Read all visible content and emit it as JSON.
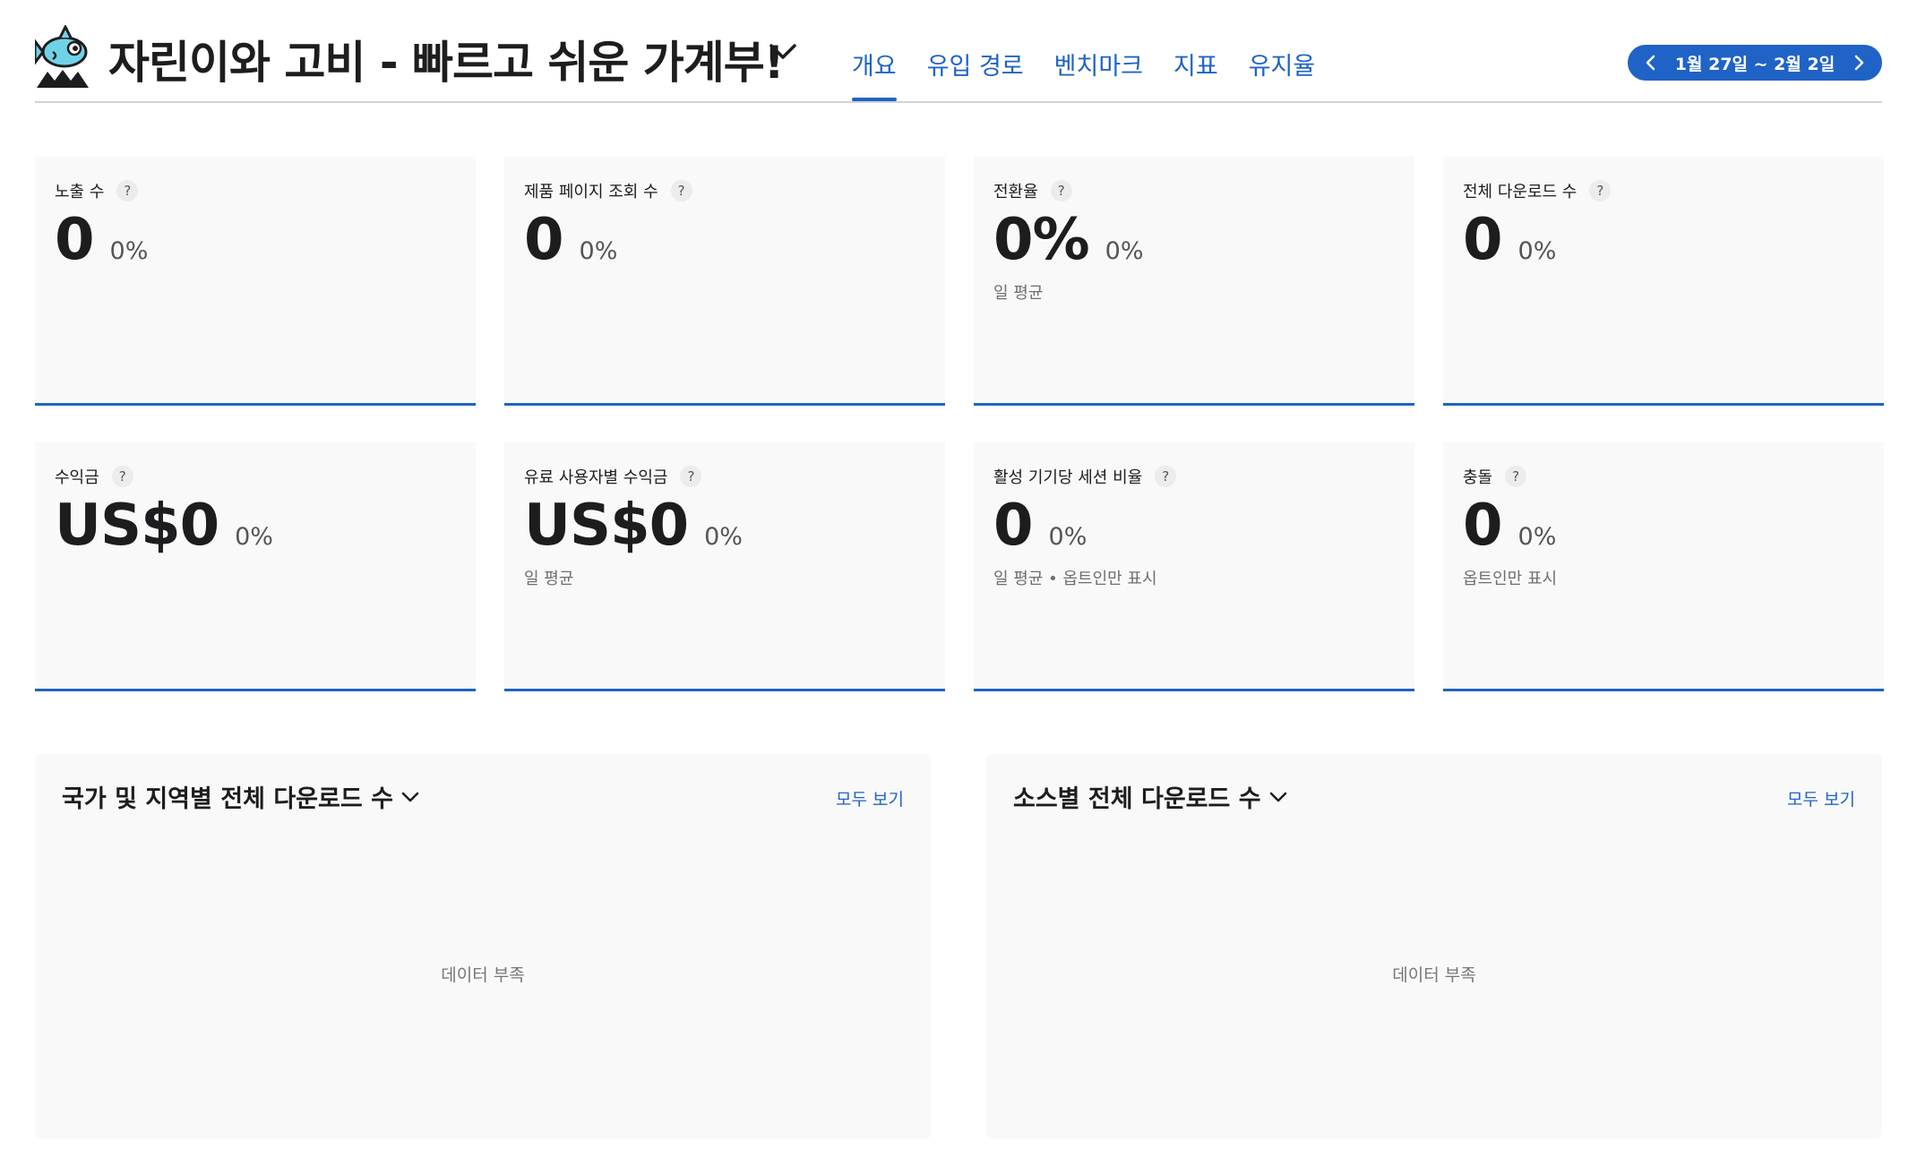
{
  "header": {
    "app_title": "자린이와 고비 - 빠르고 쉬운 가계부!",
    "tabs": [
      {
        "label": "개요",
        "active": true
      },
      {
        "label": "유입 경로"
      },
      {
        "label": "벤치마크"
      },
      {
        "label": "지표"
      },
      {
        "label": "유지율"
      }
    ],
    "date_range": "1월 27일 ~ 2월 2일"
  },
  "accent_color": "#1f63c6",
  "metrics": [
    {
      "label": "노출 수",
      "value": "0",
      "change": "0%",
      "note": ""
    },
    {
      "label": "제품 페이지 조회 수",
      "value": "0",
      "change": "0%",
      "note": ""
    },
    {
      "label": "전환율",
      "value": "0%",
      "change": "0%",
      "note": "일 평균"
    },
    {
      "label": "전체 다운로드 수",
      "value": "0",
      "change": "0%",
      "note": ""
    },
    {
      "label": "수익금",
      "value": "US$0",
      "change": "0%",
      "note": ""
    },
    {
      "label": "유료 사용자별 수익금",
      "value": "US$0",
      "change": "0%",
      "note": "일 평균"
    },
    {
      "label": "활성 기기당 세션 비율",
      "value": "0",
      "change": "0%",
      "note": "일 평균 • 옵트인만 표시"
    },
    {
      "label": "충돌",
      "value": "0",
      "change": "0%",
      "note": "옵트인만 표시"
    }
  ],
  "panels": [
    {
      "title": "국가 및 지역별 전체 다운로드 수",
      "link": "모두 보기",
      "empty": "데이터 부족"
    },
    {
      "title": "소스별 전체 다운로드 수",
      "link": "모두 보기",
      "empty": "데이터 부족"
    }
  ],
  "icons": {
    "app": "fish-app-icon",
    "title_dropdown": "chevron-down-icon",
    "prev": "chevron-left-icon",
    "next": "chevron-right-icon"
  }
}
